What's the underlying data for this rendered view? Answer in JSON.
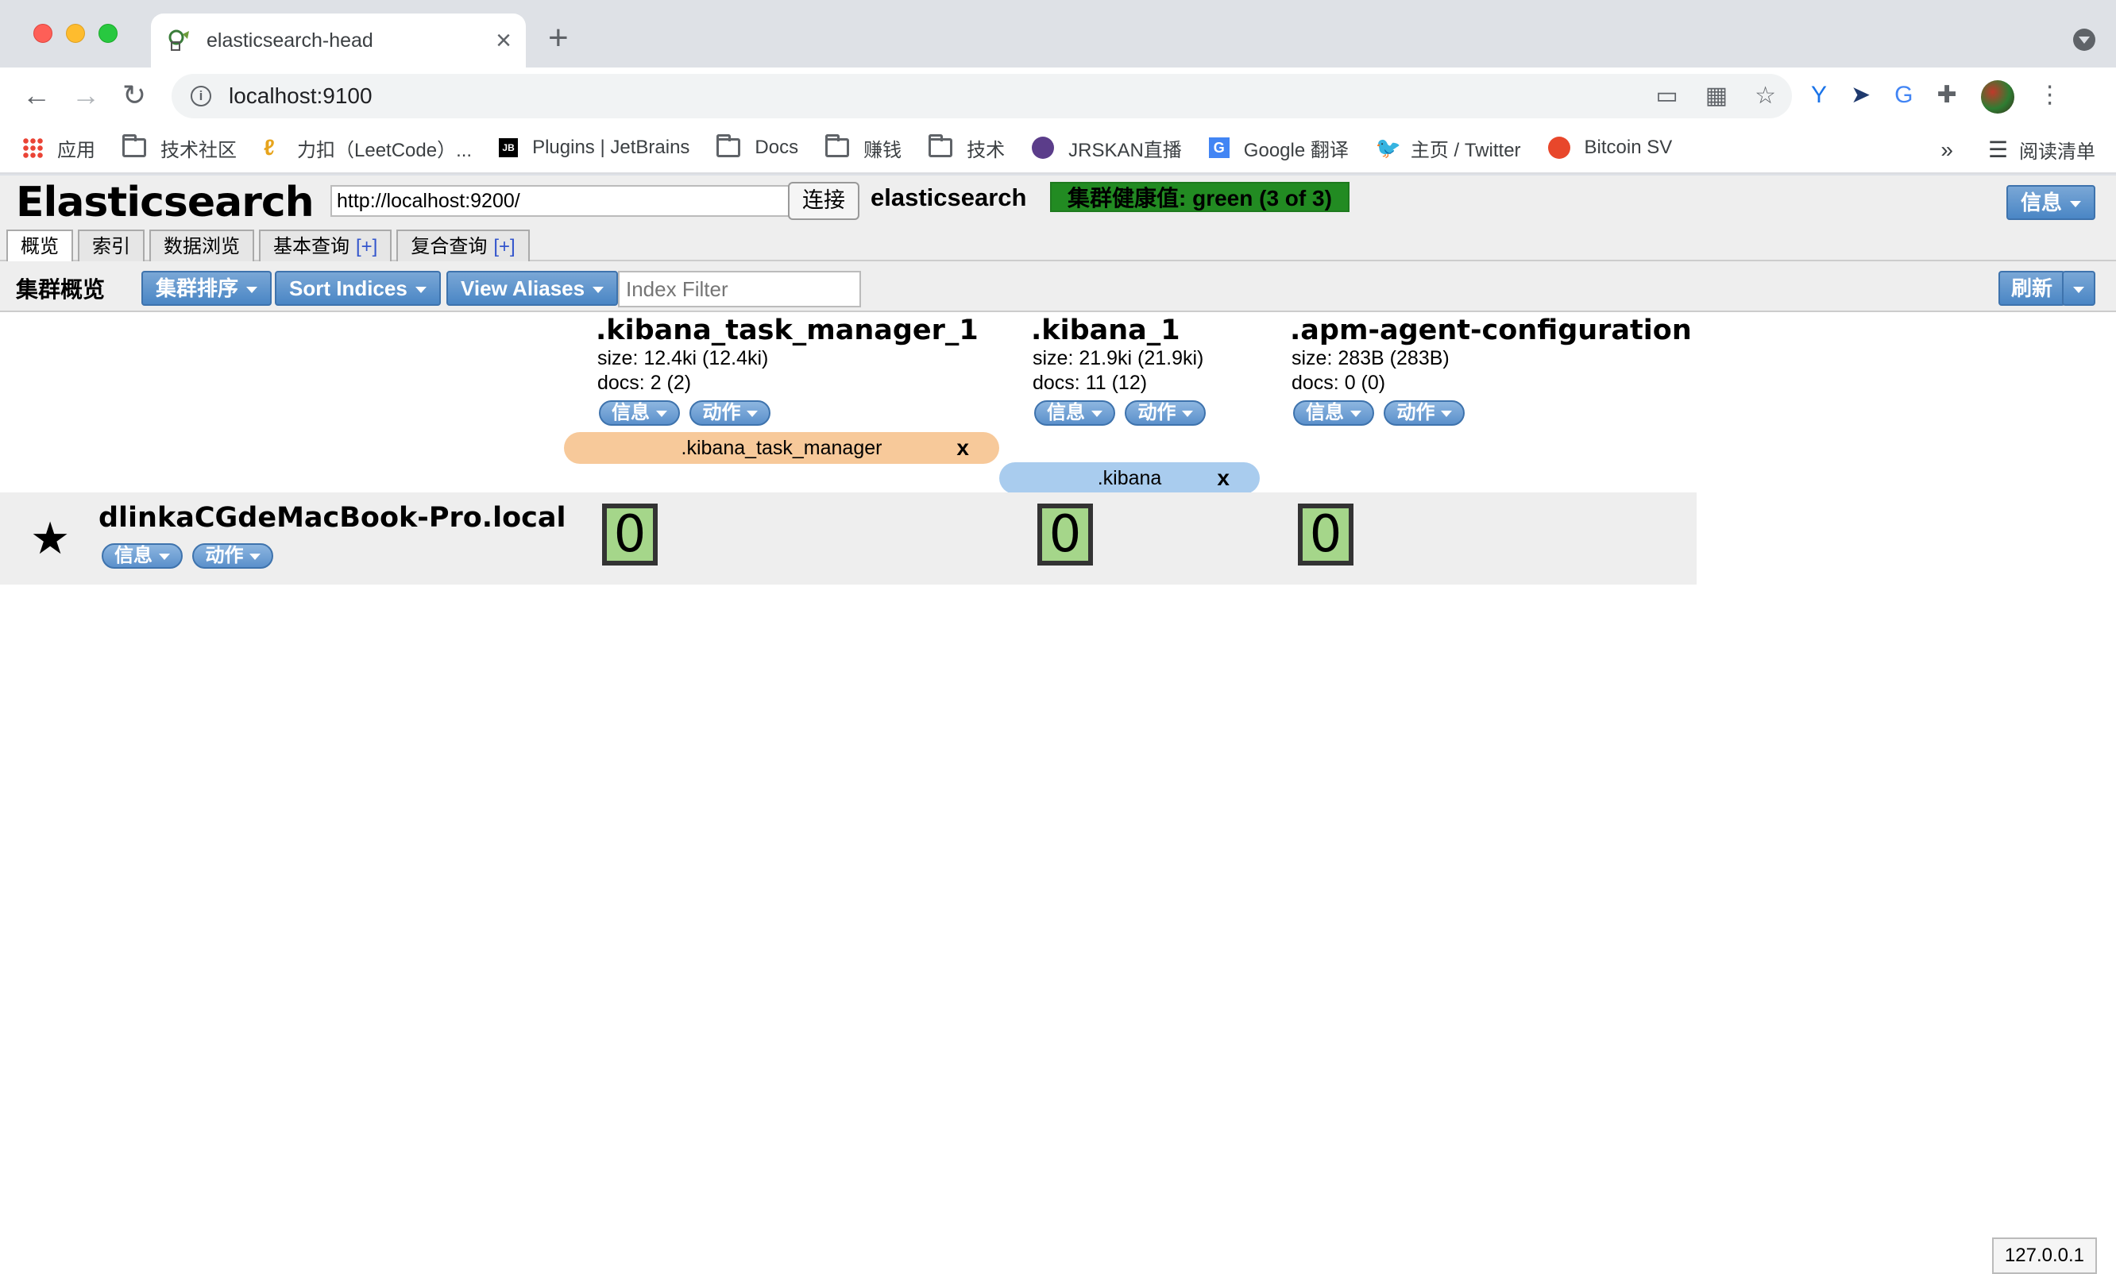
{
  "browser": {
    "tab_title": "elasticsearch-head",
    "new_tab": "+",
    "url": "localhost:9100",
    "bookmarks": [
      {
        "label": "应用",
        "icon": "apps-grid-icon"
      },
      {
        "label": "技术社区",
        "icon": "folder-icon"
      },
      {
        "label": "力扣（LeetCode）...",
        "icon": "leetcode-icon"
      },
      {
        "label": "Plugins | JetBrains",
        "icon": "jetbrains-icon"
      },
      {
        "label": "Docs",
        "icon": "folder-icon"
      },
      {
        "label": "赚钱",
        "icon": "folder-icon"
      },
      {
        "label": "技术",
        "icon": "folder-icon"
      },
      {
        "label": "JRSKAN直播",
        "icon": "jrskan-icon"
      },
      {
        "label": "Google 翻译",
        "icon": "google-translate-icon"
      },
      {
        "label": "主页 / Twitter",
        "icon": "twitter-icon"
      },
      {
        "label": "Bitcoin SV",
        "icon": "bitcoin-sv-icon"
      }
    ],
    "more_bookmarks": "»",
    "reading_list": "阅读清单"
  },
  "es": {
    "brand": "Elasticsearch",
    "connect_url": "http://localhost:9200/",
    "connect_label": "连接",
    "cluster_name": "elasticsearch",
    "health": "集群健康值: green (3 of 3)",
    "info_label": "信息",
    "tabs": [
      {
        "label": "概览",
        "plus": ""
      },
      {
        "label": "索引",
        "plus": ""
      },
      {
        "label": "数据浏览",
        "plus": ""
      },
      {
        "label": "基本查询",
        "plus": "[+]"
      },
      {
        "label": "复合查询",
        "plus": "[+]"
      }
    ],
    "overview_label": "集群概览",
    "cluster_sort": "集群排序",
    "sort_indices": "Sort Indices",
    "view_aliases": "View Aliases",
    "index_filter_placeholder": "Index Filter",
    "refresh": "刷新",
    "pill_info": "信息",
    "pill_action": "动作",
    "indices": [
      {
        "name": ".kibana_task_manager_1",
        "size": "size: 12.4ki (12.4ki)",
        "docs": "docs: 2 (2)",
        "shard": "0"
      },
      {
        "name": ".kibana_1",
        "size": "size: 21.9ki (21.9ki)",
        "docs": "docs: 11 (12)",
        "shard": "0"
      },
      {
        "name": ".apm-agent-configuration",
        "size": "size: 283B (283B)",
        "docs": "docs: 0 (0)",
        "shard": "0"
      }
    ],
    "aliases": [
      {
        "name": ".kibana_task_manager",
        "remove": "x",
        "color": "#f7c99a"
      },
      {
        "name": ".kibana",
        "remove": "x",
        "color": "#a9ccee"
      }
    ],
    "node": {
      "name": "dlinkaCGdeMacBook-Pro.local",
      "star": "★"
    },
    "footer_ip": "127.0.0.1"
  }
}
